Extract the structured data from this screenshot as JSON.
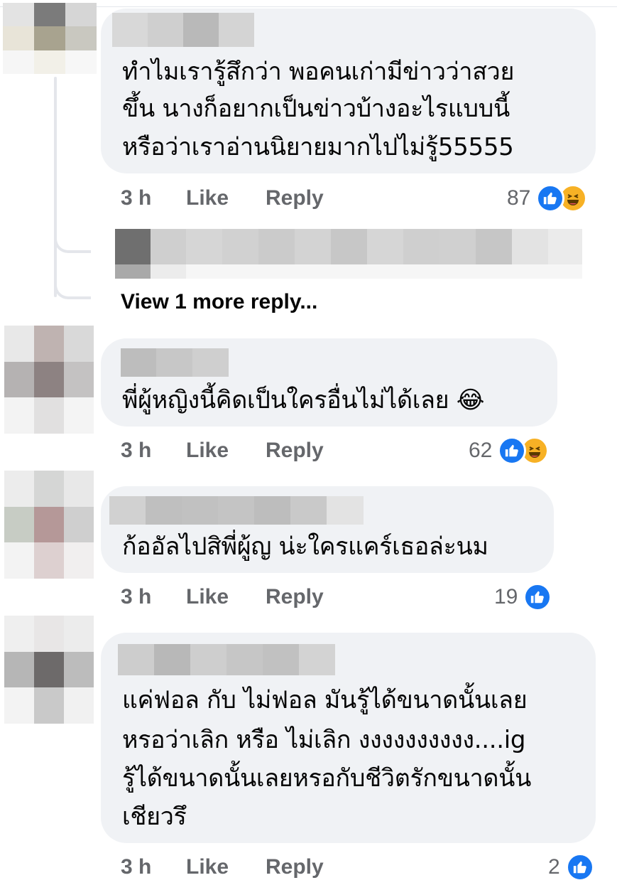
{
  "comments": [
    {
      "text_lines": [
        "ทำไมเรารู้สึกว่า พอคนเก่ามีข่าวว่าสวย",
        "ขึ้น นางก็อยากเป็นข่าวบ้างอะไรแบบนี้",
        "หรือว่าเราอ่านนิยายมากไปไม่รู้55555"
      ],
      "time": "3 h",
      "like": "Like",
      "reply": "Reply",
      "reaction_count": "87",
      "reactions": [
        "like-icon",
        "haha-icon"
      ]
    },
    {
      "text_lines": [
        "พี่ผู้หญิงนี้คิดเป็นใครอื่นไม่ได้เลย 😂"
      ],
      "time": "3 h",
      "like": "Like",
      "reply": "Reply",
      "reaction_count": "62",
      "reactions": [
        "like-icon",
        "haha-icon"
      ]
    },
    {
      "text_lines": [
        "ก้ออัลไปสิพี่ผู้ญ น่ะใครแคร์เธอล่ะนม"
      ],
      "time": "3 h",
      "like": "Like",
      "reply": "Reply",
      "reaction_count": "19",
      "reactions": [
        "like-icon"
      ]
    },
    {
      "text_lines": [
        "แค่ฟอล กับ ไม่ฟอล มันรู้ได้ขนาดนั้นเลย",
        "หรอว่าเลิก หรือ ไม่เลิก งงงงงงงงงง....ig",
        "รู้ได้ขนาดนั้นเลยหรอกับชีวิตรักขนาดนั้น",
        "เชียวรึ"
      ],
      "time": "3 h",
      "like": "Like",
      "reply": "Reply",
      "reaction_count": "2",
      "reactions": [
        "like-icon"
      ]
    }
  ],
  "view_more_replies": "View 1 more reply...",
  "colors": {
    "like_blue": "#1877f2",
    "haha_yellow": "#f7b125",
    "bubble": "#f0f2f5",
    "meta_gray": "#65676b"
  }
}
